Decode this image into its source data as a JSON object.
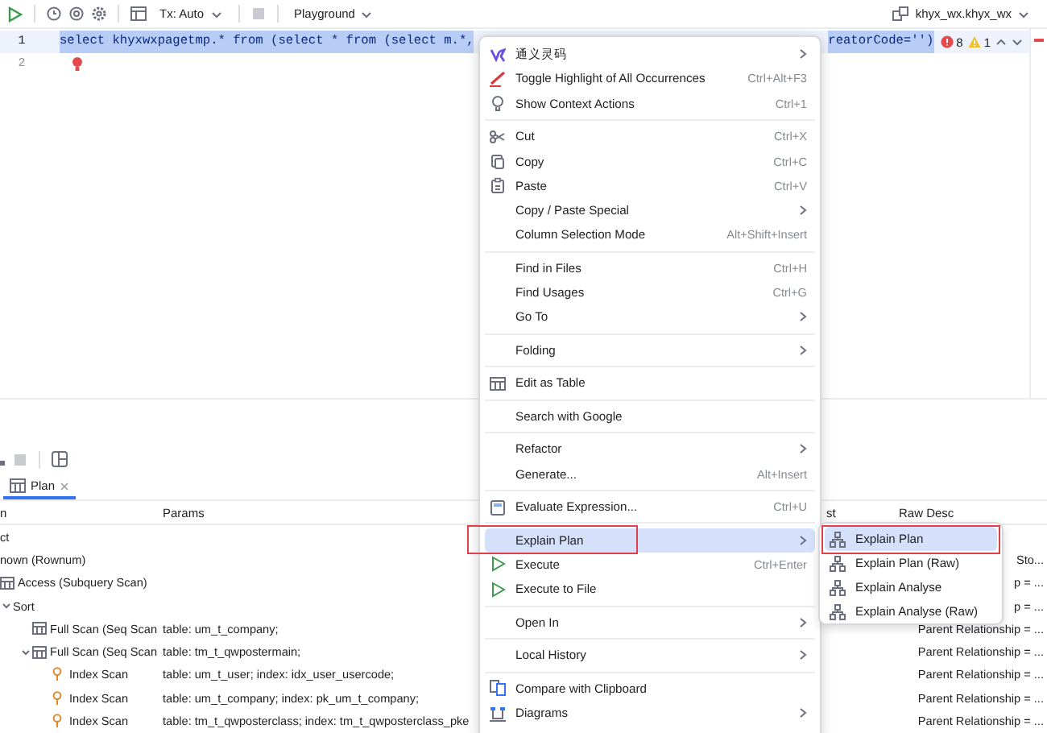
{
  "toolbar": {
    "tx_mode": "Tx: Auto",
    "playground": "Playground",
    "datasource": "khyx_wx.khyx_wx"
  },
  "editor": {
    "lines": [
      {
        "number": "1",
        "segments": [
          "select khyxwxpagetmp.* from (select * from (select m.*,",
          "reatorCode='')"
        ],
        "selected": true,
        "error": false
      },
      {
        "number": "2",
        "selected": false,
        "error": true
      }
    ],
    "errors": "8",
    "warnings": "1"
  },
  "context_menu": {
    "items": [
      {
        "kind": "item",
        "label": "通义灵码",
        "submenu": true,
        "selected": false,
        "outlined": false
      },
      {
        "kind": "item",
        "label": "Toggle Highlight of All Occurrences",
        "shortcut": "Ctrl+Alt+F3",
        "submenu": false,
        "selected": false,
        "outlined": false
      },
      {
        "kind": "item",
        "label": "Show Context Actions",
        "shortcut": "Ctrl+1",
        "submenu": false,
        "selected": false,
        "outlined": false
      },
      {
        "kind": "separator"
      },
      {
        "kind": "item",
        "label": "Cut",
        "shortcut": "Ctrl+X",
        "submenu": false,
        "selected": false,
        "outlined": false
      },
      {
        "kind": "item",
        "label": "Copy",
        "shortcut": "Ctrl+C",
        "submenu": false,
        "selected": false,
        "outlined": false
      },
      {
        "kind": "item",
        "label": "Paste",
        "shortcut": "Ctrl+V",
        "submenu": false,
        "selected": false,
        "outlined": false
      },
      {
        "kind": "item",
        "label": "Copy / Paste Special",
        "submenu": true,
        "selected": false,
        "outlined": false
      },
      {
        "kind": "item",
        "label": "Column Selection Mode",
        "shortcut": "Alt+Shift+Insert",
        "submenu": false,
        "selected": false,
        "outlined": false
      },
      {
        "kind": "separator"
      },
      {
        "kind": "item",
        "label": "Find in Files",
        "shortcut": "Ctrl+H",
        "submenu": false,
        "selected": false,
        "outlined": false
      },
      {
        "kind": "item",
        "label": "Find Usages",
        "shortcut": "Ctrl+G",
        "submenu": false,
        "selected": false,
        "outlined": false
      },
      {
        "kind": "item",
        "label": "Go To",
        "submenu": true,
        "selected": false,
        "outlined": false
      },
      {
        "kind": "separator"
      },
      {
        "kind": "item",
        "label": "Folding",
        "submenu": true,
        "selected": false,
        "outlined": false
      },
      {
        "kind": "separator"
      },
      {
        "kind": "item",
        "label": "Edit as Table",
        "submenu": false,
        "selected": false,
        "outlined": false
      },
      {
        "kind": "separator"
      },
      {
        "kind": "item",
        "label": "Search with Google",
        "submenu": false,
        "selected": false,
        "outlined": false
      },
      {
        "kind": "separator"
      },
      {
        "kind": "item",
        "label": "Refactor",
        "submenu": true,
        "selected": false,
        "outlined": false
      },
      {
        "kind": "item",
        "label": "Generate...",
        "shortcut": "Alt+Insert",
        "submenu": false,
        "selected": false,
        "outlined": false
      },
      {
        "kind": "separator"
      },
      {
        "kind": "item",
        "label": "Evaluate Expression...",
        "shortcut": "Ctrl+U",
        "submenu": false,
        "selected": false,
        "outlined": false
      },
      {
        "kind": "separator"
      },
      {
        "kind": "item",
        "label": "Explain Plan",
        "submenu": true,
        "selected": true,
        "outlined": true
      },
      {
        "kind": "item",
        "label": "Execute",
        "shortcut": "Ctrl+Enter",
        "submenu": false,
        "selected": false,
        "outlined": false
      },
      {
        "kind": "item",
        "label": "Execute to File",
        "submenu": false,
        "selected": false,
        "outlined": false
      },
      {
        "kind": "separator"
      },
      {
        "kind": "item",
        "label": "Open In",
        "submenu": true,
        "selected": false,
        "outlined": false
      },
      {
        "kind": "separator"
      },
      {
        "kind": "item",
        "label": "Local History",
        "submenu": true,
        "selected": false,
        "outlined": false
      },
      {
        "kind": "separator"
      },
      {
        "kind": "item",
        "label": "Compare with Clipboard",
        "submenu": false,
        "selected": false,
        "outlined": false
      },
      {
        "kind": "item",
        "label": "Diagrams",
        "submenu": true,
        "selected": false,
        "outlined": false
      }
    ]
  },
  "submenu": {
    "items": [
      {
        "label": "Explain Plan",
        "selected": true,
        "outlined": true
      },
      {
        "label": "Explain Plan (Raw)",
        "selected": false,
        "outlined": false
      },
      {
        "label": "Explain Analyse",
        "selected": false,
        "outlined": false
      },
      {
        "label": "Explain Analyse (Raw)",
        "selected": false,
        "outlined": false
      }
    ]
  },
  "results": {
    "tabs": [
      {
        "label": "Plan",
        "selected": true
      }
    ],
    "columns": [
      "n",
      "Params",
      "st",
      "Raw Desc"
    ],
    "rows": [
      {
        "operation": "ct",
        "children": [
          {
            "operation": "nown (Rownum)",
            "raw_desc": "Sto...",
            "children": [
              {
                "kind": "table",
                "operation": "Access (Subquery Scan)",
                "raw_desc": "p = ...",
                "children": [
                  {
                    "operation": "Sort",
                    "raw_desc": "p = ...",
                    "expanded": true,
                    "children": [
                      {
                        "kind": "table",
                        "operation": "Full Scan (Seq Scan",
                        "params": "table: um_t_company;",
                        "raw_desc": "Parent Relationship = ..."
                      },
                      {
                        "kind": "table",
                        "operation": "Full Scan (Seq Scan",
                        "params": "table: tm_t_qwpostermain;",
                        "raw_desc": "Parent Relationship = ...",
                        "expanded": true,
                        "children": [
                          {
                            "kind": "index",
                            "operation": "Index Scan",
                            "params": "table: um_t_user; index: idx_user_usercode;",
                            "raw_desc": "Parent Relationship = ..."
                          },
                          {
                            "kind": "index",
                            "operation": "Index Scan",
                            "params": "table: um_t_company; index: pk_um_t_company;",
                            "raw_desc": "Parent Relationship = ..."
                          },
                          {
                            "kind": "index",
                            "operation": "Index Scan",
                            "params": "table: tm_t_qwposterclass; index: tm_t_qwposterclass_pke",
                            "raw_desc": "Parent Relationship = ..."
                          }
                        ]
                      }
                    ]
                  }
                ]
              }
            ]
          }
        ]
      }
    ]
  }
}
